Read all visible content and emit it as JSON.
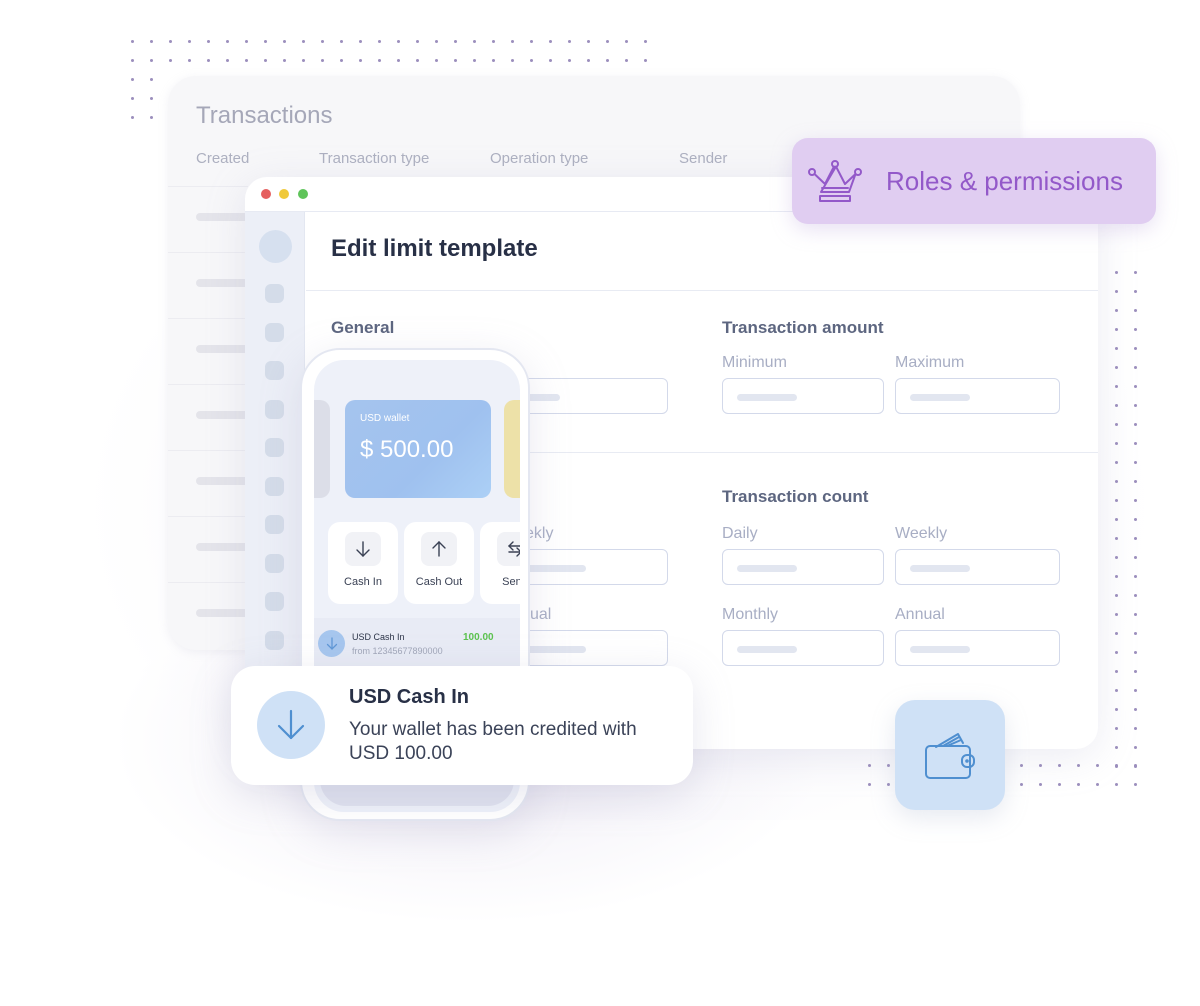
{
  "colors": {
    "accent_purple": "#9359c9",
    "roles_bg": "#e0cdf1",
    "wallet_blue": "#cfe1f6",
    "icon_blue": "#4f8fd0",
    "positive_green": "#5cc24f",
    "traffic_red": "#e55f5f",
    "traffic_yellow": "#f0c93a",
    "traffic_green": "#5fc45a"
  },
  "transactions_card": {
    "title": "Transactions",
    "columns": [
      "Created",
      "Transaction type",
      "Operation type",
      "Sender"
    ],
    "row_count": 7
  },
  "roles_badge": {
    "icon": "crown-icon",
    "label": "Roles & permissions"
  },
  "window": {
    "title": "Edit limit template",
    "sidebar_item_count": 10,
    "sections": {
      "general": {
        "title": "General"
      },
      "amount": {
        "title": "Transaction amount",
        "fields": [
          {
            "label": "Minimum",
            "value": ""
          },
          {
            "label": "Maximum",
            "value": ""
          }
        ]
      },
      "volume_partial": {
        "fields": [
          {
            "label": "Weekly",
            "visible_fragment": "ekly",
            "value": ""
          },
          {
            "label": "Annual",
            "visible_fragment": "ual",
            "value": ""
          }
        ]
      },
      "count": {
        "title": "Transaction count",
        "fields": [
          {
            "label": "Daily",
            "value": ""
          },
          {
            "label": "Weekly",
            "value": ""
          },
          {
            "label": "Monthly",
            "value": ""
          },
          {
            "label": "Annual",
            "value": ""
          }
        ]
      }
    }
  },
  "phone": {
    "wallet_card": {
      "name": "USD wallet",
      "balance": "$ 500.00"
    },
    "actions": [
      {
        "label": "Cash In",
        "icon": "arrow-down-icon"
      },
      {
        "label": "Cash Out",
        "icon": "arrow-up-icon"
      },
      {
        "label": "Send",
        "icon": "swap-arrows-icon"
      }
    ],
    "recent_transaction": {
      "title": "USD Cash In",
      "subtitle": "from 12345677890000",
      "amount": "100.00"
    }
  },
  "notification": {
    "icon": "arrow-down-icon",
    "title": "USD Cash In",
    "body": "Your wallet has been credited with USD 100.00"
  },
  "wallet_tile": {
    "icon": "wallet-icon"
  }
}
